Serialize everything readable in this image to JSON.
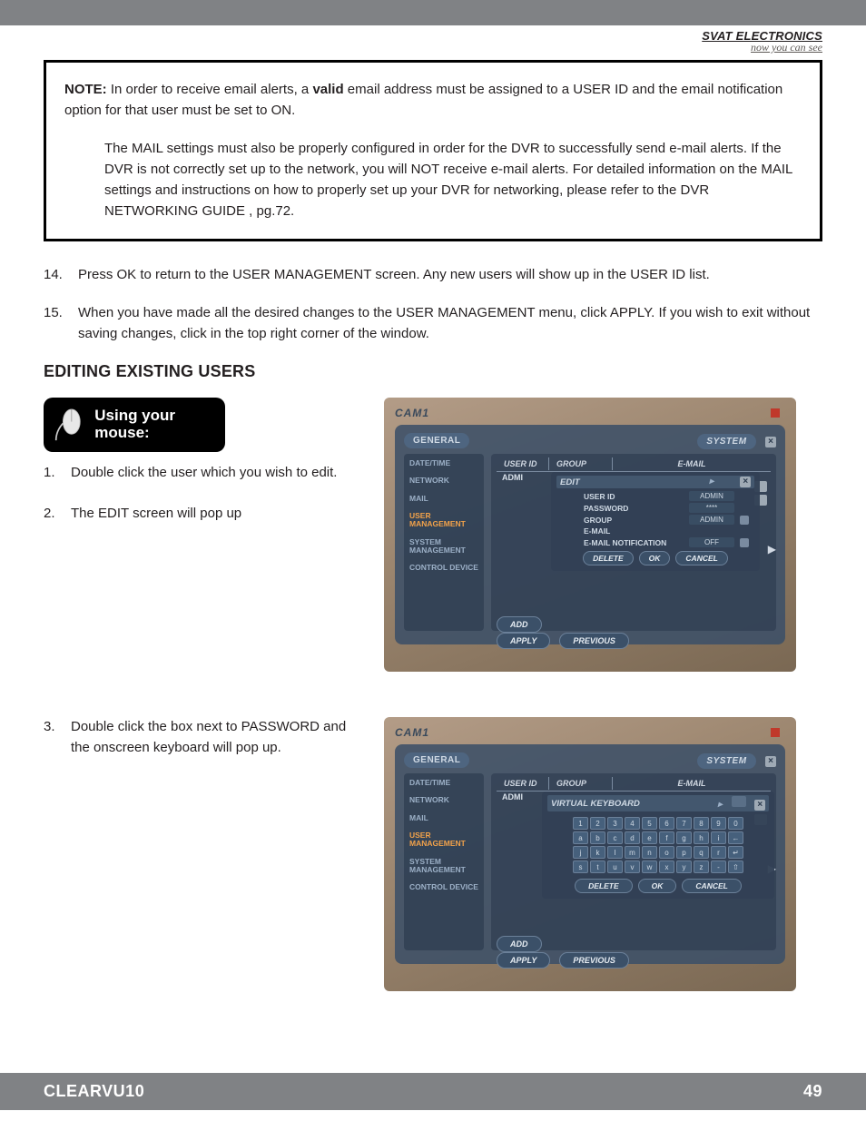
{
  "header": {
    "brand": "SVAT ELECTRONICS",
    "tagline": "now you can see"
  },
  "note": {
    "label": "NOTE:",
    "p1a": "In order to receive email alerts, a ",
    "p1b_bold": "valid",
    "p1c": " email address must be assigned to a USER ID and the email notification option for that user must be set to ON.",
    "p2": "The MAIL settings must also be properly configured in order for the DVR to successfully send e-mail alerts.  If the DVR is not correctly set up to the network, you will NOT receive e-mail alerts. For detailed information on the MAIL settings and instructions on how to properly set up your DVR for networking, please refer to the DVR NETWORKING GUIDE , pg.72."
  },
  "steps_top": [
    {
      "num": "14.",
      "text": "Press OK to return to the USER MANAGEMENT screen.  Any new users will show up in the USER ID list."
    },
    {
      "num": "15.",
      "text": "When you have made all the desired changes to the USER MANAGEMENT menu, click APPLY.  If you wish to exit without saving changes, click in the top right corner of the window."
    }
  ],
  "section_title": "EDITING EXISTING USERS",
  "mouse_card": "Using your mouse:",
  "steps_edit": [
    {
      "num": "1.",
      "text": "Double click the user which you wish to edit."
    },
    {
      "num": "2.",
      "text": "The EDIT screen will pop up"
    }
  ],
  "steps_vk": [
    {
      "num": "3.",
      "text": "Double click the box next to PASSWORD and the onscreen keyboard will pop up."
    }
  ],
  "dvr": {
    "cam": "CAM1",
    "tab_left": "GENERAL",
    "tab_right": "SYSTEM",
    "side_items": [
      "DATE/TIME",
      "NETWORK",
      "MAIL",
      "USER MANAGEMENT",
      "SYSTEM MANAGEMENT",
      "CONTROL DEVICE"
    ],
    "col_headers": {
      "c1": "USER ID",
      "c2": "GROUP",
      "c3": "E-MAIL"
    },
    "row_user": "ADMI",
    "btn_add": "ADD",
    "btn_apply": "APPLY",
    "btn_prev": "PREVIOUS"
  },
  "edit_popup": {
    "title": "EDIT",
    "fields": {
      "user_id": {
        "label": "USER ID",
        "value": "ADMIN"
      },
      "password": {
        "label": "PASSWORD",
        "value": "****"
      },
      "group": {
        "label": "GROUP",
        "value": "ADMIN"
      },
      "email": {
        "label": "E-MAIL",
        "value": ""
      },
      "notif": {
        "label": "E-MAIL NOTIFICATION",
        "value": "OFF"
      }
    },
    "btn_delete": "DELETE",
    "btn_ok": "OK",
    "btn_cancel": "CANCEL"
  },
  "vk_popup": {
    "title": "VIRTUAL KEYBOARD",
    "rows": [
      [
        "1",
        "2",
        "3",
        "4",
        "5",
        "6",
        "7",
        "8",
        "9",
        "0"
      ],
      [
        "a",
        "b",
        "c",
        "d",
        "e",
        "f",
        "g",
        "h",
        "i",
        "←"
      ],
      [
        "j",
        "k",
        "l",
        "m",
        "n",
        "o",
        "p",
        "q",
        "r",
        "↵"
      ],
      [
        "s",
        "t",
        "u",
        "v",
        "w",
        "x",
        "y",
        "z",
        "-",
        "⇧"
      ]
    ],
    "btn_delete": "DELETE",
    "btn_ok": "OK",
    "btn_cancel": "CANCEL"
  },
  "footer": {
    "model": "CLEARVU10",
    "page": "49"
  }
}
